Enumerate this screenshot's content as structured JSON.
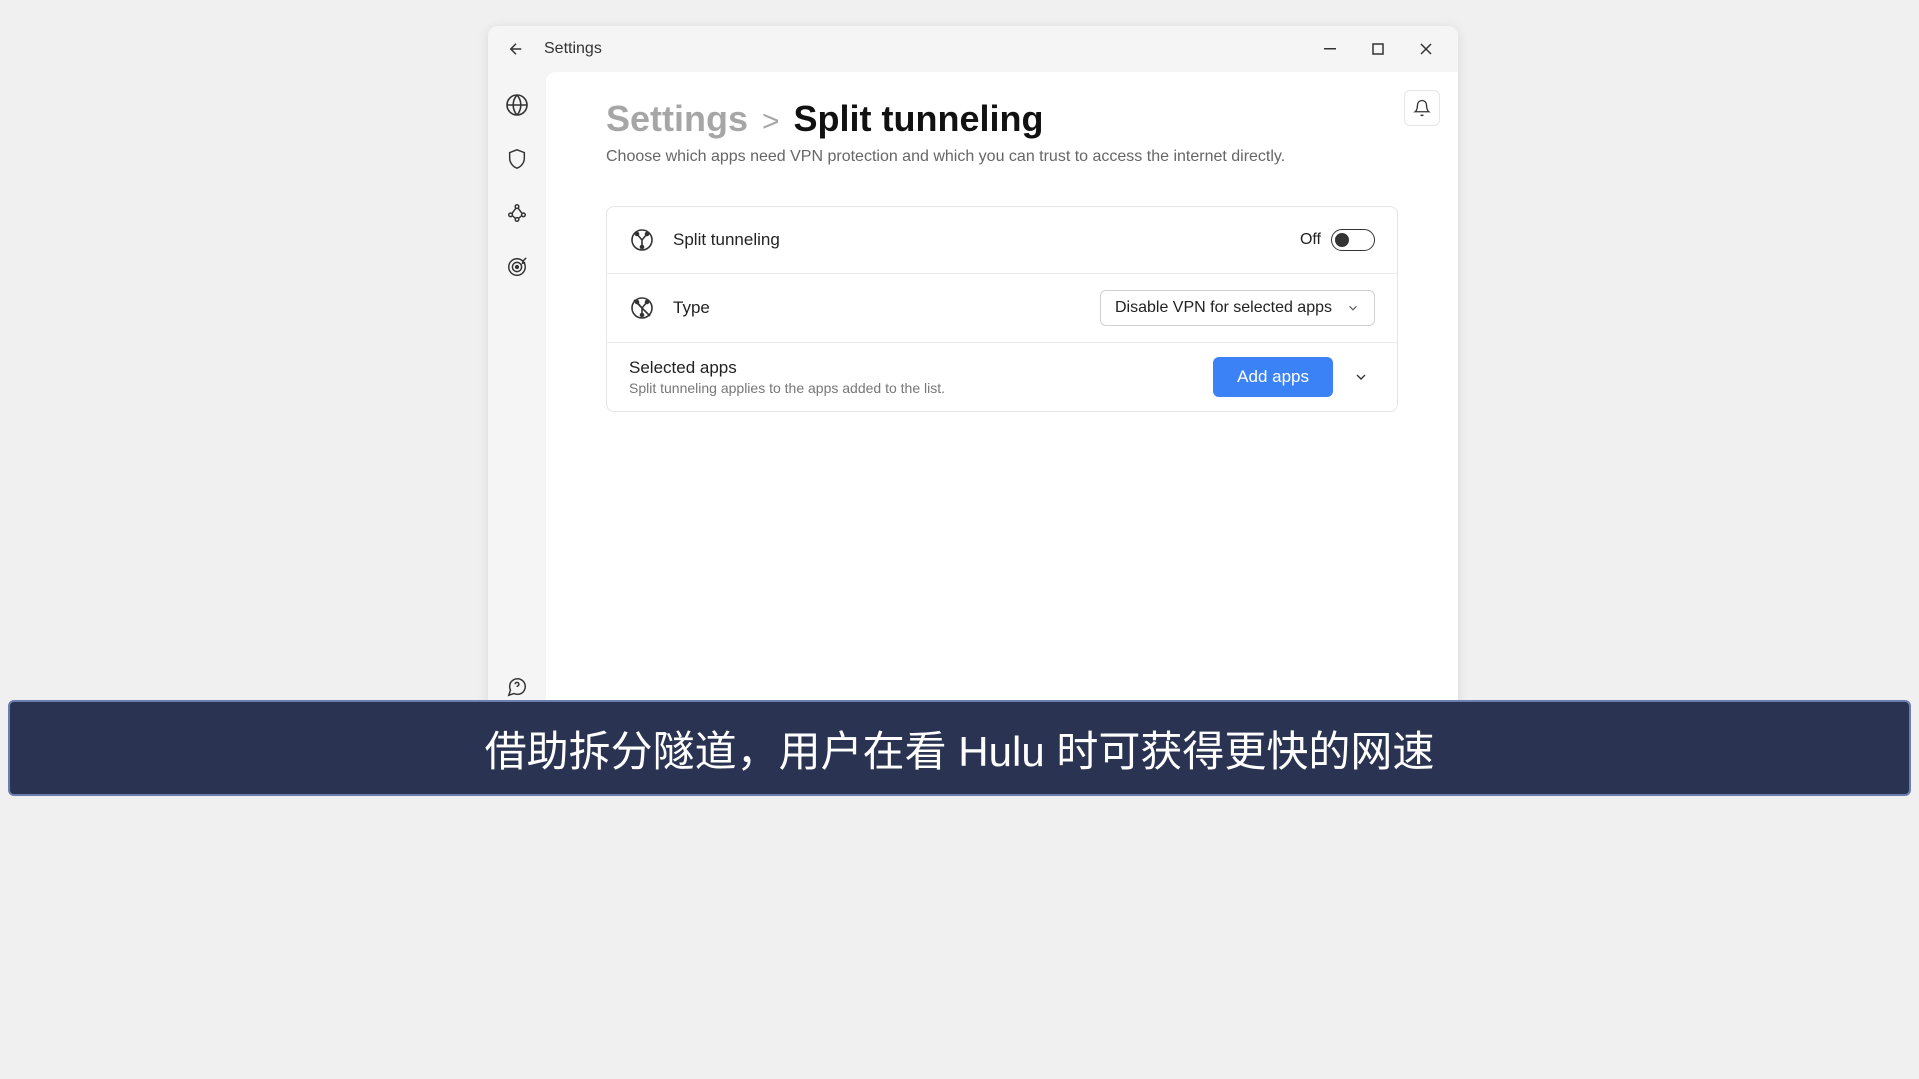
{
  "titlebar": {
    "title": "Settings"
  },
  "breadcrumb": {
    "parent": "Settings",
    "separator": ">",
    "current": "Split tunneling"
  },
  "subtitle": "Choose which apps need VPN protection and which you can trust to access the internet directly.",
  "rows": {
    "splitTunneling": {
      "label": "Split tunneling",
      "state": "Off"
    },
    "type": {
      "label": "Type",
      "selected": "Disable VPN for selected apps"
    },
    "selectedApps": {
      "title": "Selected apps",
      "subtitle": "Split tunneling applies to the apps added to the list.",
      "button": "Add apps"
    }
  },
  "caption": "借助拆分隧道，用户在看 Hulu 时可获得更快的网速"
}
